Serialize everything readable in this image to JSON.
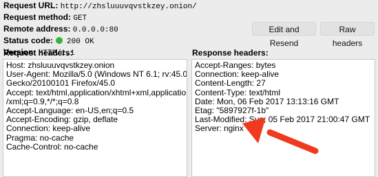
{
  "summary": {
    "request_url_label": "Request URL:",
    "request_url": "http://zhsluuuvqvstkzey.onion/",
    "request_method_label": "Request method:",
    "request_method": "GET",
    "remote_address_label": "Remote address:",
    "remote_address": "0.0.0.0:80",
    "status_code_label": "Status code:",
    "status_code": "200 OK",
    "status_color": "#3cb043",
    "version_label": "Version:",
    "version": "HTTP/1.1"
  },
  "buttons": {
    "edit_resend": "Edit and Resend",
    "raw_headers": "Raw headers"
  },
  "request_headers": {
    "label": "Request headers:",
    "lines": [
      "Host: zhsluuuvqvstkzey.onion",
      "User-Agent: Mozilla/5.0 (Windows NT 6.1; rv:45.0)",
      "Gecko/20100101 Firefox/45.0",
      "Accept: text/html,application/xhtml+xml,application",
      "/xml;q=0.9,*/*;q=0.8",
      "Accept-Language: en-US,en;q=0.5",
      "Accept-Encoding: gzip, deflate",
      "Connection: keep-alive",
      "Pragma: no-cache",
      "Cache-Control: no-cache"
    ]
  },
  "response_headers": {
    "label": "Response headers:",
    "lines": [
      "Accept-Ranges: bytes",
      "Connection: keep-alive",
      "Content-Length: 27",
      "Content-Type: text/html",
      "Date: Mon, 06 Feb 2017 13:13:16 GMT",
      "Etag: \"5897927f-1b\"",
      "Last-Modified: Sun, 05 Feb 2017 21:00:47 GMT",
      "Server: nginx"
    ]
  },
  "annotation": {
    "arrow_color": "#f0391e"
  }
}
